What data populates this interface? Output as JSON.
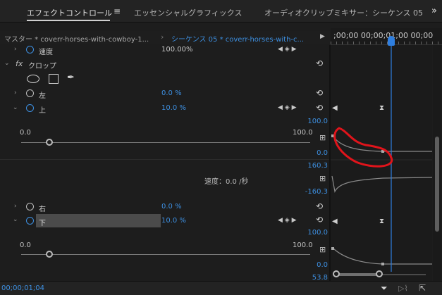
{
  "tabs": {
    "effect_controls": "エフェクトコントロール",
    "menu_glyph": "≡",
    "essential_graphics": "エッセンシャルグラフィックス",
    "audio_mixer": "オーディオクリップミキサー：シーケンス 05",
    "more": "»"
  },
  "clip_tabs": {
    "master": "マスター * coverr-horses-with-cowboy-1...",
    "sequence": "シーケンス 05 * coverr-horses-with-c...",
    "play": "▶"
  },
  "timecode_ruler": ";00;00 00;00;01;00 00;00",
  "properties": {
    "speed": {
      "label": "速度",
      "value": "100.00%"
    },
    "crop": {
      "label": "クロップ",
      "fx": "fx"
    },
    "left": {
      "label": "左",
      "value": "0.0 %"
    },
    "top": {
      "label": "上",
      "value": "10.0 %",
      "slider_min": "0.0",
      "slider_max": "100.0",
      "graph_top": "100.0",
      "graph_zero": "0.0",
      "vel_top": "160.3",
      "vel_bottom": "-160.3",
      "velocity_label": "速度：0.0 /秒"
    },
    "right": {
      "label": "右",
      "value": "0.0 %"
    },
    "bottom": {
      "label": "下",
      "value": "10.0 %",
      "slider_min": "0.0",
      "slider_max": "100.0",
      "graph_top": "100.0",
      "graph_zero": "0.0",
      "graph_next": "53.8"
    }
  },
  "footer": {
    "timecode": "00;00;01;04"
  },
  "colors": {
    "accent": "#3d8fe0",
    "playhead": "#2f7fe0",
    "annotation": "#e0141b",
    "bg": "#1d1d1d"
  }
}
